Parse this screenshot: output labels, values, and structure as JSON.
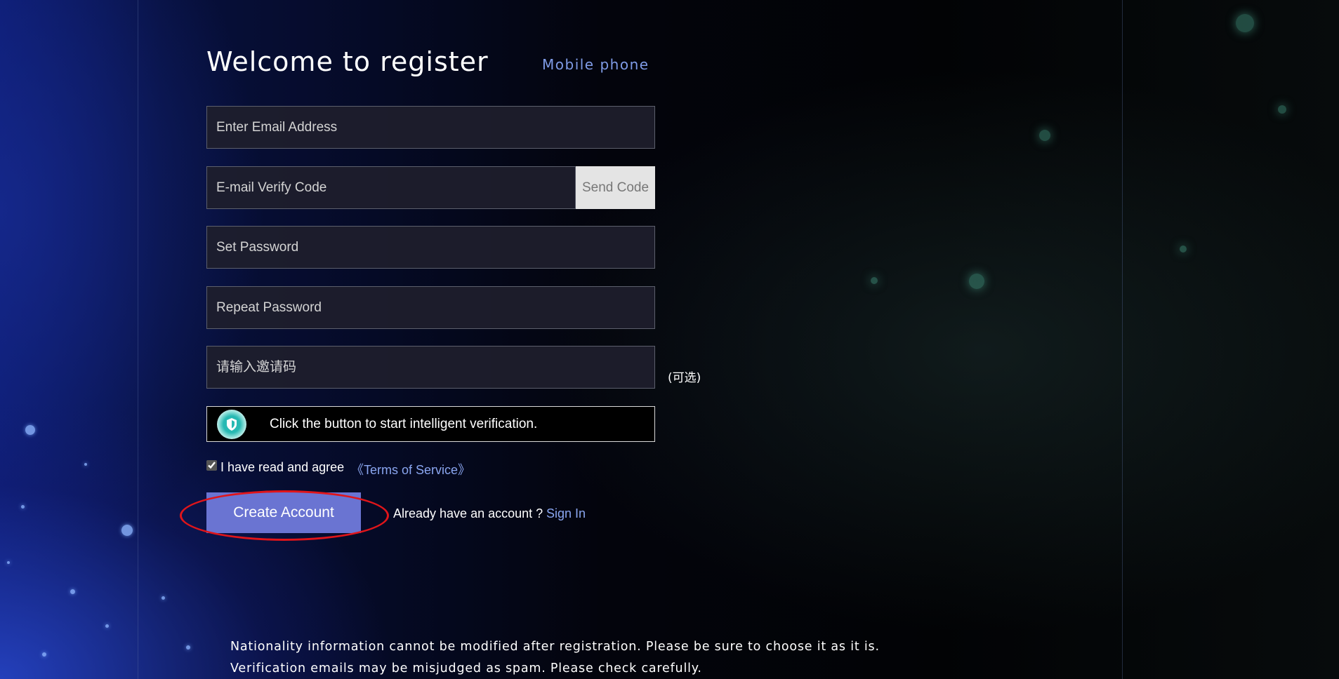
{
  "header": {
    "title": "Welcome to register",
    "mobile_link": "Mobile phone"
  },
  "form": {
    "email_placeholder": "Enter Email Address",
    "verify_code_placeholder": "E-mail Verify Code",
    "send_code_label": "Send Code",
    "password_placeholder": "Set Password",
    "repeat_password_placeholder": "Repeat Password",
    "invite_code_placeholder": "请输入邀请码",
    "invite_optional_label": "(可选)",
    "captcha_text": "Click the button to start intelligent verification.",
    "agree_checked": true,
    "agree_text": "I have read and agree",
    "tos_link": "《Terms of Service》",
    "create_account_label": "Create Account",
    "have_account_text": "Already have an account ?",
    "sign_in_link": "Sign In"
  },
  "notices": [
    "Nationality information cannot be modified after registration. Please be sure to choose it as it is.",
    "Verification emails may be misjudged as spam. Please check carefully."
  ],
  "colors": {
    "accent_button": "#6a74d2",
    "link": "#8aa6f0",
    "highlight_ellipse": "#e0151a",
    "captcha_icon": "#27b9b3"
  },
  "icons": {
    "captcha": "shield-check-icon"
  }
}
